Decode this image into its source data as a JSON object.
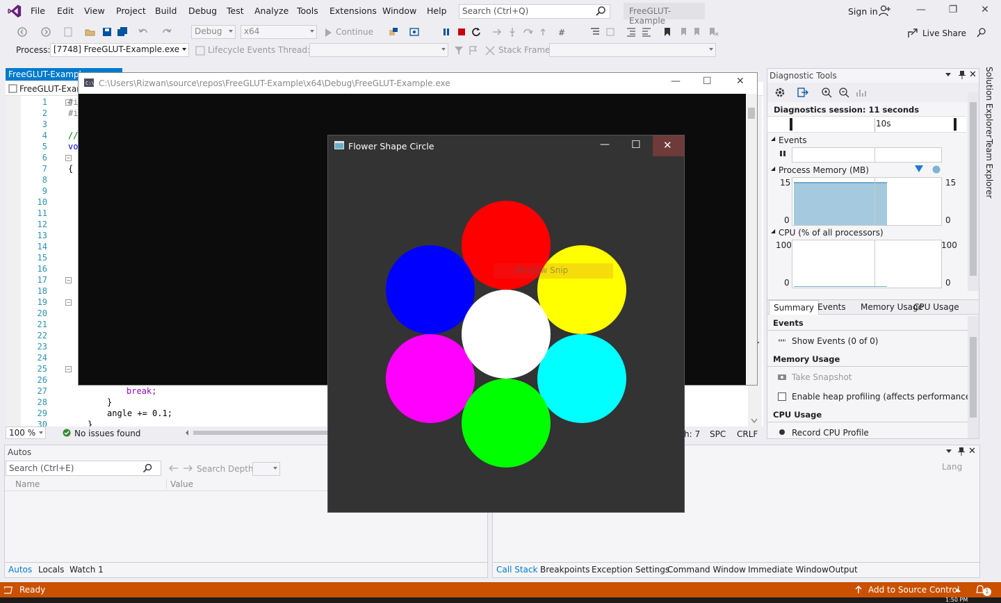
{
  "menubar": {
    "items": [
      "File",
      "Edit",
      "View",
      "Project",
      "Build",
      "Debug",
      "Test",
      "Analyze",
      "Tools",
      "Extensions",
      "Window",
      "Help"
    ],
    "search_placeholder": "Search (Ctrl+Q)",
    "solution_name": "FreeGLUT-Example",
    "sign_in": "Sign in"
  },
  "toolbar": {
    "configuration": "Debug",
    "platform": "x64",
    "continue_label": "Continue",
    "live_share": "Live Share",
    "process_label": "Process:",
    "process_value": "[7748] FreeGLUT-Example.exe",
    "lifecycle_events": "Lifecycle Events",
    "thread_label": "Thread:",
    "stack_frame_label": "Stack Frame:"
  },
  "editor": {
    "tab_title": "FreeGLUT-Example",
    "nav_scope": "FreeGLUT-Exam",
    "line_numbers": [
      "1",
      "2",
      "3",
      "4",
      "5",
      "6",
      "7",
      "8",
      "9",
      "10",
      "11",
      "12",
      "13",
      "14",
      "15",
      "16",
      "17",
      "18",
      "19",
      "20",
      "21",
      "22",
      "23",
      "24",
      "25",
      "26",
      "27",
      "28",
      "29",
      "30"
    ],
    "code_fragments": {
      "l1": "#i",
      "l2": "#i",
      "l4": "//",
      "l5": "vo",
      "l7": "{",
      "l27": "break;",
      "l28": "}",
      "l29": "angle += 0.1;",
      "l30": "}"
    },
    "zoom": "100 %",
    "issues": "No issues found",
    "col_info": "h: 7",
    "spacing": "SPC",
    "line_ending": "CRLF"
  },
  "console": {
    "title": "C:\\Users\\Rizwan\\source\\repos\\FreeGLUT-Example\\x64\\Debug\\FreeGLUT-Example.exe"
  },
  "glut_window": {
    "title": "Flower Shape Circle",
    "overlay_text": "Window Snip",
    "petal_colors": {
      "top": "#ff0000",
      "upper_left": "#0000ff",
      "upper_right": "#ffff00",
      "center": "#ffffff",
      "lower_left": "#ff00ff",
      "lower_right": "#00ffff",
      "bottom": "#00ff00"
    }
  },
  "diagnostics": {
    "title": "Diagnostic Tools",
    "session": "Diagnostics session: 11 seconds",
    "timeline_label": "10s",
    "events_header": "Events",
    "memory_header": "Process Memory (MB)",
    "memory_max": "15",
    "memory_min": "0",
    "cpu_header": "CPU (% of all processors)",
    "cpu_max": "100",
    "cpu_min": "0",
    "tabs": [
      "Summary",
      "Events",
      "Memory Usage",
      "CPU Usage"
    ],
    "summary_events": "Events",
    "show_events": "Show Events (0 of 0)",
    "memory_usage": "Memory Usage",
    "take_snapshot": "Take Snapshot",
    "heap_profiling": "Enable heap profiling (affects performance)",
    "cpu_usage": "CPU Usage",
    "record_cpu": "Record CPU Profile"
  },
  "side_tabs": [
    "Solution Explorer",
    "Team Explorer"
  ],
  "autos": {
    "title": "Autos",
    "search_placeholder": "Search (Ctrl+E)",
    "search_depth": "Search Depth:",
    "columns": [
      "Name",
      "Value"
    ],
    "tabs": [
      "Autos",
      "Locals",
      "Watch 1"
    ]
  },
  "callstack": {
    "column": "Lang",
    "tabs": [
      "Call Stack",
      "Breakpoints",
      "Exception Settings",
      "Command Window",
      "Immediate Window",
      "Output"
    ]
  },
  "statusbar": {
    "ready": "Ready",
    "source_control": "Add to Source Control",
    "notifications": "1",
    "clock": "1:50 PM"
  },
  "colors": {
    "accent": "#007acc",
    "status_bar": "#ca5100",
    "console_bg": "#0c0c0c",
    "glut_bg": "#333333"
  }
}
